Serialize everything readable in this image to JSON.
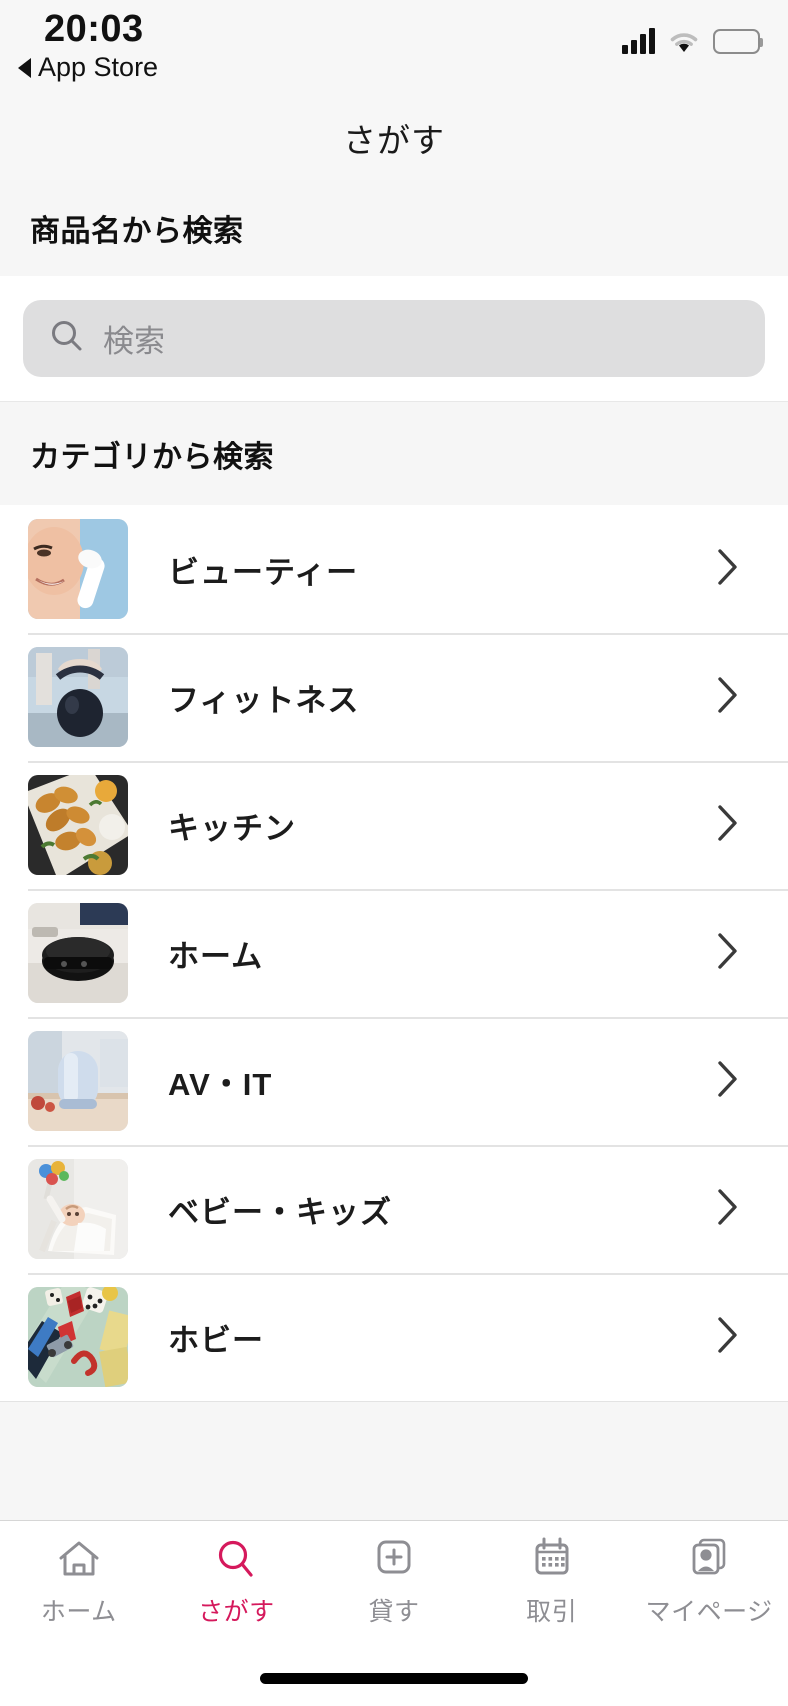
{
  "status_bar": {
    "time": "20:03",
    "back_label": "App Store",
    "signal_icon": "cellular-signal-icon",
    "wifi_icon": "wifi-icon",
    "battery_icon": "battery-full-icon"
  },
  "nav": {
    "title": "さがす"
  },
  "search_section": {
    "header": "商品名から検索",
    "placeholder": "検索",
    "value": "",
    "icon": "search-icon"
  },
  "category_section": {
    "header": "カテゴリから検索",
    "items": [
      {
        "label": "ビューティー",
        "thumb": "beauty-device-photo"
      },
      {
        "label": "フィットネス",
        "thumb": "kettlebell-photo"
      },
      {
        "label": "キッチン",
        "thumb": "chicken-wings-photo"
      },
      {
        "label": "ホーム",
        "thumb": "robot-vacuum-photo"
      },
      {
        "label": "AV・IT",
        "thumb": "smart-speaker-photo"
      },
      {
        "label": "ベビー・キッズ",
        "thumb": "baby-bouncer-photo"
      },
      {
        "label": "ホビー",
        "thumb": "board-game-photo"
      }
    ],
    "chevron_icon": "chevron-right-icon"
  },
  "tab_bar": {
    "active_color": "#D5195C",
    "inactive_color": "#8E8E93",
    "tabs": [
      {
        "label": "ホーム",
        "icon": "home-icon",
        "active": false
      },
      {
        "label": "さがす",
        "icon": "search-icon",
        "active": true
      },
      {
        "label": "貸す",
        "icon": "plus-square-icon",
        "active": false
      },
      {
        "label": "取引",
        "icon": "calendar-icon",
        "active": false
      },
      {
        "label": "マイページ",
        "icon": "profile-cards-icon",
        "active": false
      }
    ]
  },
  "home_indicator": "home-indicator-bar"
}
